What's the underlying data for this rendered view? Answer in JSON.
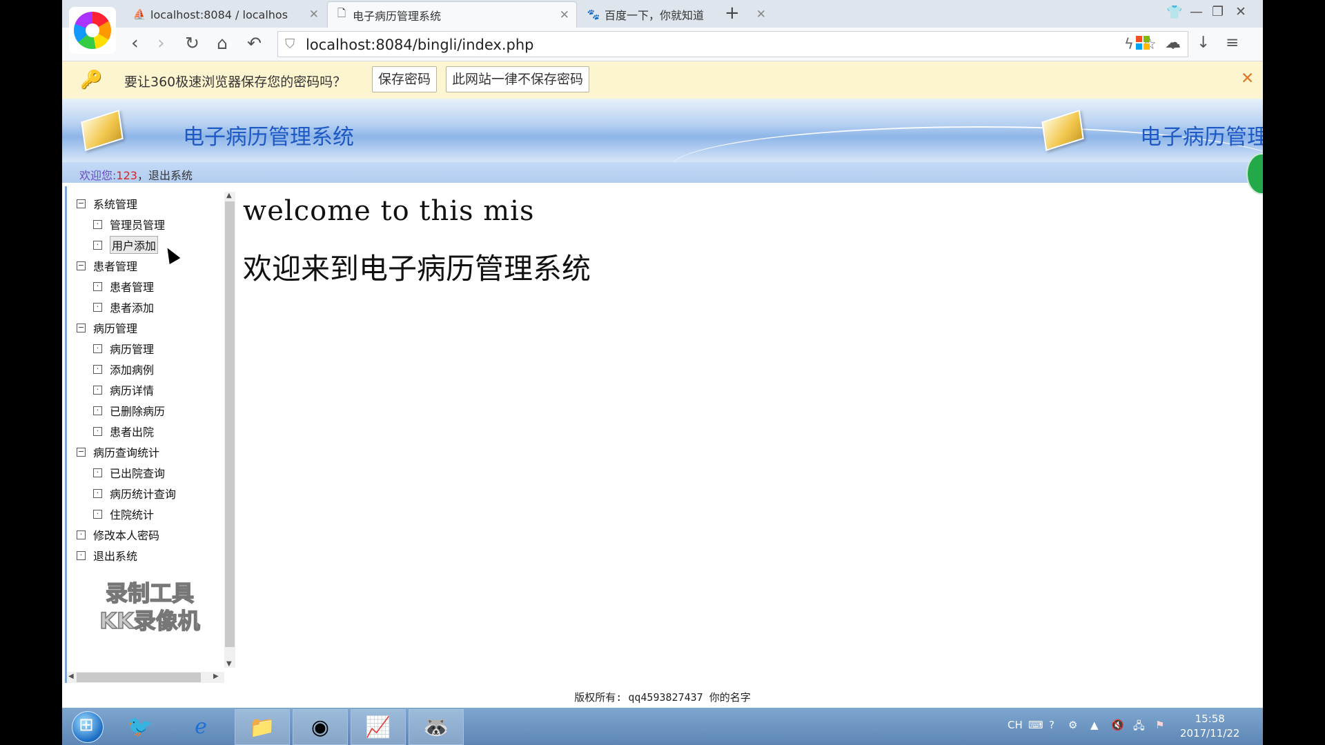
{
  "browser": {
    "tabs": [
      {
        "label": "localhost:8084 / localhos",
        "favicon": "phpmyadmin-icon"
      },
      {
        "label": "电子病历管理系统",
        "favicon": "page-icon"
      },
      {
        "label": "百度一下，你就知道",
        "favicon": "baidu-paw-icon"
      }
    ],
    "url": "localhost:8084/bingli/index.php",
    "password_bar": {
      "message": "要让360极速浏览器保存您的密码吗？",
      "save_label": "保存密码",
      "never_label": "此网站一律不保存密码"
    }
  },
  "header": {
    "title": "电子病历管理系统",
    "title_repeat": "电子病历管理"
  },
  "welcome": {
    "label": "欢迎您:",
    "user": "123",
    "logout": "退出系统"
  },
  "menu": [
    {
      "label": "系统管理",
      "type": "group"
    },
    {
      "label": "管理员管理",
      "type": "item"
    },
    {
      "label": "用户添加",
      "type": "item",
      "hover": true
    },
    {
      "label": "患者管理",
      "type": "group"
    },
    {
      "label": "患者管理",
      "type": "item"
    },
    {
      "label": "患者添加",
      "type": "item"
    },
    {
      "label": "病历管理",
      "type": "group"
    },
    {
      "label": "病历管理",
      "type": "item"
    },
    {
      "label": "添加病例",
      "type": "item"
    },
    {
      "label": "病历详情",
      "type": "item"
    },
    {
      "label": "已删除病历",
      "type": "item"
    },
    {
      "label": "患者出院",
      "type": "item"
    },
    {
      "label": "病历查询统计",
      "type": "group"
    },
    {
      "label": "已出院查询",
      "type": "item"
    },
    {
      "label": "病历统计查询",
      "type": "item"
    },
    {
      "label": "住院统计",
      "type": "item"
    },
    {
      "label": "修改本人密码",
      "type": "leaf"
    },
    {
      "label": "退出系统",
      "type": "leaf"
    }
  ],
  "watermark": [
    "录制工具",
    "KK录像机"
  ],
  "main": {
    "welcome_en": "welcome to this mis",
    "welcome_zh": "欢迎来到电子病历管理系统"
  },
  "footer": {
    "text": "版权所有: qq4593827437 你的名字"
  },
  "taskbar": {
    "tray_lang": "CH",
    "time": "15:58",
    "date": "2017/11/22"
  },
  "colors": {
    "header_title": "#1e59c4",
    "welcome_user": "#d3262a",
    "password_bar_bg": "#fdf5cf",
    "taskbar": "#6b93c2"
  }
}
